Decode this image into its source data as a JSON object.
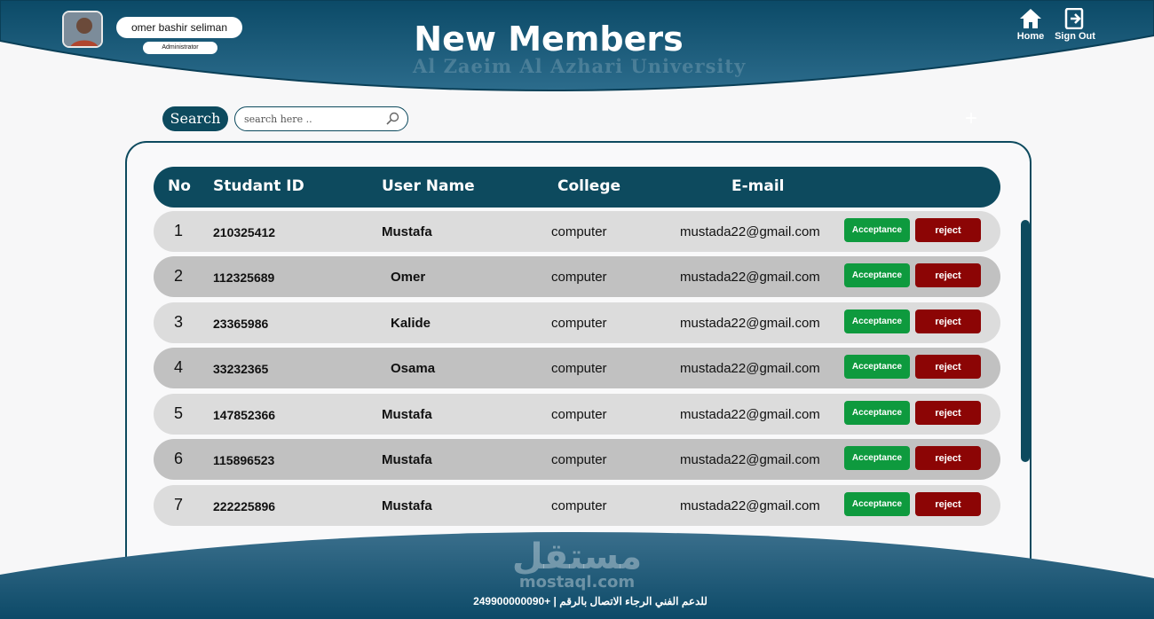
{
  "header": {
    "title": "New Members",
    "watermark": "Al Zaeim Al Azhari University",
    "user_name": "omer bashir seliman",
    "user_role": "Administrator",
    "nav": {
      "home_label": "Home",
      "signout_label": "Sign Out"
    }
  },
  "search": {
    "label": "Search",
    "placeholder": "search here .."
  },
  "table": {
    "columns": [
      "No",
      "Studant ID",
      "User Name",
      "College",
      "E-mail"
    ],
    "accept_label": "Acceptance",
    "reject_label": "reject",
    "rows": [
      {
        "no": "1",
        "id": "210325412",
        "name": "Mustafa",
        "college": "computer",
        "email": "mustada22@gmail.com"
      },
      {
        "no": "2",
        "id": "112325689",
        "name": "Omer",
        "college": "computer",
        "email": "mustada22@gmail.com"
      },
      {
        "no": "3",
        "id": "23365986",
        "name": "Kalide",
        "college": "computer",
        "email": "mustada22@gmail.com"
      },
      {
        "no": "4",
        "id": "33232365",
        "name": "Osama",
        "college": "computer",
        "email": "mustada22@gmail.com"
      },
      {
        "no": "5",
        "id": "147852366",
        "name": "Mustafa",
        "college": "computer",
        "email": "mustada22@gmail.com"
      },
      {
        "no": "6",
        "id": "115896523",
        "name": "Mustafa",
        "college": "computer",
        "email": "mustada22@gmail.com"
      },
      {
        "no": "7",
        "id": "222225896",
        "name": "Mustafa",
        "college": "computer",
        "email": "mustada22@gmail.com"
      }
    ]
  },
  "footer": {
    "logo_ar": "مستقل",
    "logo_en": "mostaql.com",
    "support_text": "للدعم الفني الرجاء الاتصال بالرقم  |  +249900000090"
  },
  "colors": {
    "primary": "#0d4a5e",
    "accept": "#0e9a3e",
    "reject": "#8c0505",
    "row_light": "#dcdcdc",
    "row_dark": "#c1c1c1"
  }
}
